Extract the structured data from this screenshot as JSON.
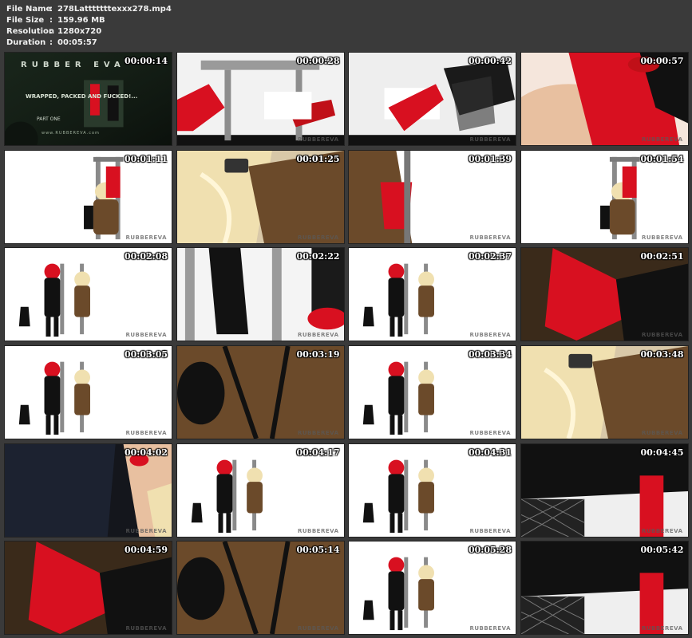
{
  "file_info": {
    "file_name_label": "File Name",
    "file_name": "278Latttttttexxx278.mp4",
    "file_size_label": "File Size",
    "file_size": "159.96 MB",
    "resolution_label": "Resolution",
    "resolution": "1280x720",
    "duration_label": "Duration",
    "duration": "00:05:57",
    "separator": ":"
  },
  "title_card": {
    "logo": "RUBBER EVA",
    "subtitle": "WRAPPED, PACKED AND FUCKED!...",
    "part": "PART ONE",
    "url": "www.RUBBEREVA.com"
  },
  "watermark": "RUBBEREVA",
  "thumbnails": [
    {
      "timestamp": "00:00:14",
      "scene": "title"
    },
    {
      "timestamp": "00:00:28",
      "scene": "chair-boot"
    },
    {
      "timestamp": "00:00:42",
      "scene": "heels"
    },
    {
      "timestamp": "00:00:57",
      "scene": "closeup-red"
    },
    {
      "timestamp": "00:01:11",
      "scene": "chair-seated"
    },
    {
      "timestamp": "00:01:25",
      "scene": "closeup-blonde"
    },
    {
      "timestamp": "00:01:39",
      "scene": "closeup-leg"
    },
    {
      "timestamp": "00:01:54",
      "scene": "chair-seated"
    },
    {
      "timestamp": "00:02:08",
      "scene": "two-figures"
    },
    {
      "timestamp": "00:02:22",
      "scene": "boot-closeup"
    },
    {
      "timestamp": "00:02:37",
      "scene": "two-figures"
    },
    {
      "timestamp": "00:02:51",
      "scene": "closeup-glove"
    },
    {
      "timestamp": "00:03:05",
      "scene": "two-figures"
    },
    {
      "timestamp": "00:03:19",
      "scene": "closeup-latex"
    },
    {
      "timestamp": "00:03:34",
      "scene": "two-figures"
    },
    {
      "timestamp": "00:03:48",
      "scene": "closeup-blonde"
    },
    {
      "timestamp": "00:04:02",
      "scene": "closeup-dark"
    },
    {
      "timestamp": "00:04:17",
      "scene": "two-figures"
    },
    {
      "timestamp": "00:04:31",
      "scene": "two-figures"
    },
    {
      "timestamp": "00:04:45",
      "scene": "closeup-fishnet"
    },
    {
      "timestamp": "00:04:59",
      "scene": "closeup-glove"
    },
    {
      "timestamp": "00:05:14",
      "scene": "closeup-latex"
    },
    {
      "timestamp": "00:05:28",
      "scene": "two-figures"
    },
    {
      "timestamp": "00:05:42",
      "scene": "closeup-fishnet"
    }
  ],
  "colors": {
    "background": "#3a3a3a",
    "accent_red": "#d81020",
    "latex_black": "#141414",
    "latex_brown": "#6b4a2a",
    "skin": "#e8c0a0",
    "blonde": "#f0e0b0"
  }
}
